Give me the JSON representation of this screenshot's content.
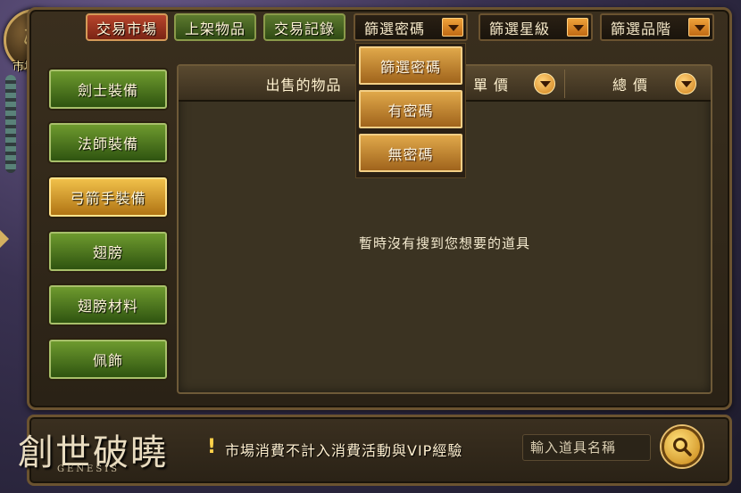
{
  "emblem": {
    "label": "市場"
  },
  "tabs": [
    {
      "label": "交易市場",
      "active": true
    },
    {
      "label": "上架物品",
      "active": false
    },
    {
      "label": "交易記錄",
      "active": false
    }
  ],
  "filters": [
    {
      "label": "篩選密碼"
    },
    {
      "label": "篩選星級"
    },
    {
      "label": "篩選品階"
    }
  ],
  "dropdown": {
    "options": [
      "篩選密碼",
      "有密碼",
      "無密碼"
    ]
  },
  "categories": [
    {
      "label": "劍士裝備",
      "selected": false
    },
    {
      "label": "法師裝備",
      "selected": false
    },
    {
      "label": "弓箭手裝備",
      "selected": true
    },
    {
      "label": "翅膀",
      "selected": false
    },
    {
      "label": "翅膀材料",
      "selected": false
    },
    {
      "label": "佩飾",
      "selected": false
    }
  ],
  "table": {
    "columns": [
      "出售的物品",
      "單 價",
      "總 價"
    ],
    "empty_message": "暫時沒有搜到您想要的道具"
  },
  "footer": {
    "logo": "創世破曉",
    "logo_sub": "GENESIS",
    "notice": "市場消費不計入消費活動與VIP經驗",
    "search_placeholder": "輸入道具名稱"
  }
}
